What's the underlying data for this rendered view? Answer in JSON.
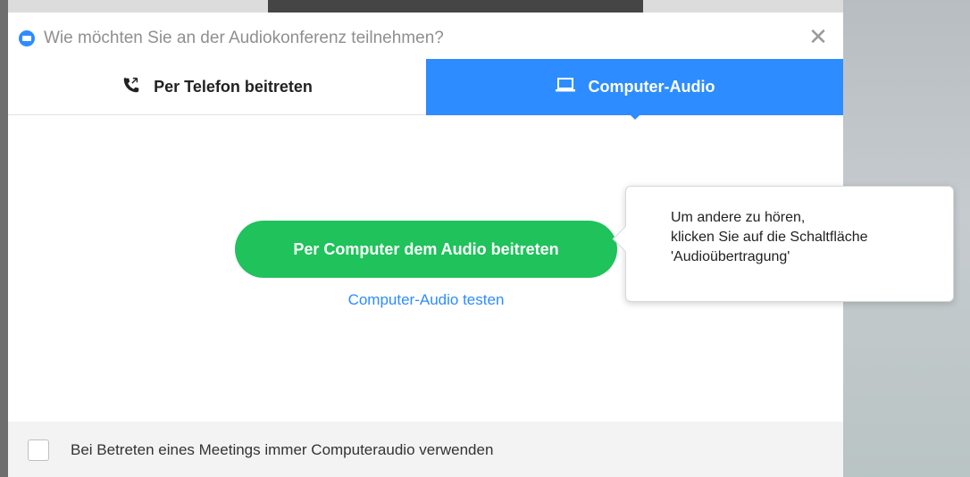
{
  "window": {
    "title": "Wie möchten Sie an der Audiokonferenz teilnehmen?",
    "app_icon": "zoom-camera-icon",
    "close_glyph": "✕"
  },
  "tabs": [
    {
      "label": "Per Telefon beitreten",
      "icon": "phone-icon",
      "active": false
    },
    {
      "label": "Computer-Audio",
      "icon": "laptop-icon",
      "active": true
    }
  ],
  "main": {
    "join_button_label": "Per Computer dem Audio beitreten",
    "test_link_label": "Computer-Audio testen"
  },
  "tooltip": {
    "lines": [
      "Um andere zu hören,",
      "klicken Sie auf die Schaltfläche",
      "'Audioübertragung'"
    ]
  },
  "footer": {
    "checkbox_label": "Bei Betreten eines Meetings immer Computeraudio verwenden",
    "checked": false
  },
  "colors": {
    "accent_blue": "#2d8cff",
    "join_green": "#1fc25b"
  }
}
